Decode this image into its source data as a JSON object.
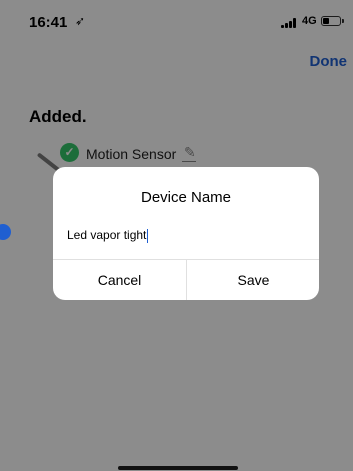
{
  "status_bar": {
    "time": "16:41",
    "network": "4G"
  },
  "header": {
    "done_label": "Done"
  },
  "main": {
    "heading": "Added.",
    "device": {
      "name": "Motion Sensor"
    }
  },
  "dialog": {
    "title": "Device Name",
    "input_value": "Led vapor tight",
    "cancel_label": "Cancel",
    "save_label": "Save"
  },
  "colors": {
    "accent": "#1f5fd1",
    "success": "#34c76a",
    "overlay": "rgba(0,0,0,0.45)"
  }
}
